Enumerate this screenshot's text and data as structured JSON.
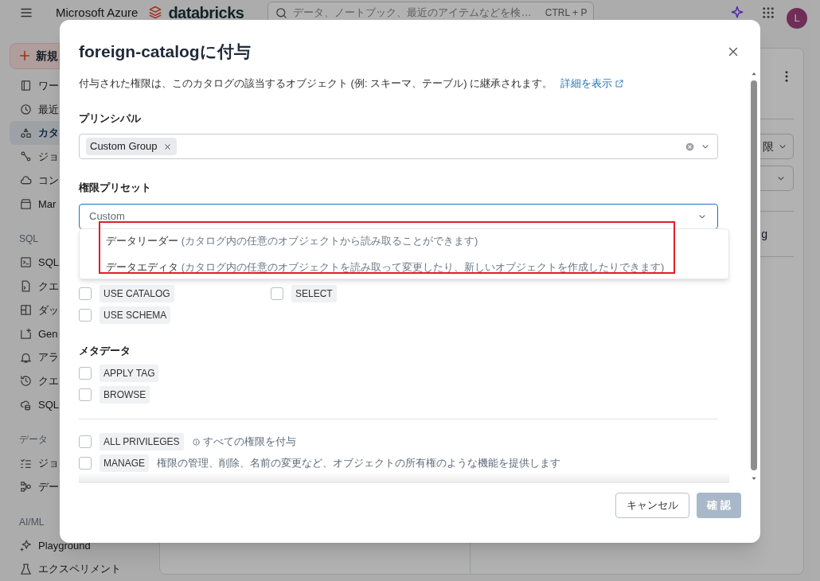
{
  "topbar": {
    "product": "Microsoft Azure",
    "brand": "databricks",
    "search_placeholder": "データ、ノートブック、最近のアイテムなどを検…",
    "shortcut": "CTRL + P",
    "avatar": "L"
  },
  "sidebar": {
    "new_button": "新規",
    "items": [
      {
        "kind": "item",
        "label": "ワー",
        "selected": false
      },
      {
        "kind": "item",
        "label": "最近",
        "selected": false
      },
      {
        "kind": "item",
        "label": "カタ",
        "selected": true
      },
      {
        "kind": "item",
        "label": "ジョ",
        "selected": false
      },
      {
        "kind": "item",
        "label": "コン",
        "selected": false
      },
      {
        "kind": "item",
        "label": "Mar",
        "selected": false
      },
      {
        "kind": "heading",
        "label": "SQL"
      },
      {
        "kind": "item",
        "label": "SQL",
        "selected": false
      },
      {
        "kind": "item",
        "label": "クエ",
        "selected": false
      },
      {
        "kind": "item",
        "label": "ダッ",
        "selected": false
      },
      {
        "kind": "item",
        "label": "Gen",
        "selected": false
      },
      {
        "kind": "item",
        "label": "アラ",
        "selected": false
      },
      {
        "kind": "item",
        "label": "クエ",
        "selected": false
      },
      {
        "kind": "item",
        "label": "SQL",
        "selected": false
      },
      {
        "kind": "heading",
        "label": "データ"
      },
      {
        "kind": "item",
        "label": "ジョ",
        "selected": false
      },
      {
        "kind": "item",
        "label": "デー",
        "selected": false
      },
      {
        "kind": "heading",
        "label": "AI/ML"
      },
      {
        "kind": "item",
        "label": "Playground",
        "selected": false
      },
      {
        "kind": "item",
        "label": "エクスペリメント",
        "selected": false
      }
    ]
  },
  "background": {
    "filter_value": "限",
    "row_text": "g"
  },
  "dialog": {
    "title": "foreign-catalogに付与",
    "description": "付与された権限は、このカタログの該当するオブジェクト (例:  スキーマ、テーブル) に継承されます。",
    "details_link": "詳細を表示",
    "principal_label": "プリンシパル",
    "principals": [
      "Custom Group"
    ],
    "preset_label": "権限プリセット",
    "preset_value": "Custom",
    "preset_options": [
      {
        "name": "データリーダー",
        "detail": "(カタログ内の任意のオブジェクトから読み取ることができます)"
      },
      {
        "name": "データエディタ",
        "detail": "(カタログ内の任意のオブジェクトを読み取って変更したり、新しいオブジェクトを作成したりできます)"
      }
    ],
    "groups": [
      {
        "kind": "grid",
        "privileges": [
          {
            "name": "USE CATALOG",
            "checked": false
          },
          {
            "name": "SELECT",
            "checked": false
          },
          {
            "name": "USE SCHEMA",
            "checked": false
          }
        ]
      },
      {
        "heading": "メタデータ",
        "kind": "list",
        "privileges": [
          {
            "name": "APPLY TAG",
            "checked": false
          },
          {
            "name": "BROWSE",
            "checked": false
          }
        ]
      },
      {
        "divider": true,
        "kind": "list",
        "privileges": [
          {
            "name": "ALL PRIVILEGES",
            "checked": false,
            "info": true,
            "note": "すべての権限を付与"
          },
          {
            "name": "MANAGE",
            "checked": false,
            "info": false,
            "note": "権限の管理、削除、名前の変更など、オブジェクトの所有権のような機能を提供します"
          }
        ]
      }
    ],
    "buttons": [
      {
        "label": "キャンセル",
        "disabled": false
      },
      {
        "label": "確 認",
        "disabled": true
      }
    ]
  }
}
